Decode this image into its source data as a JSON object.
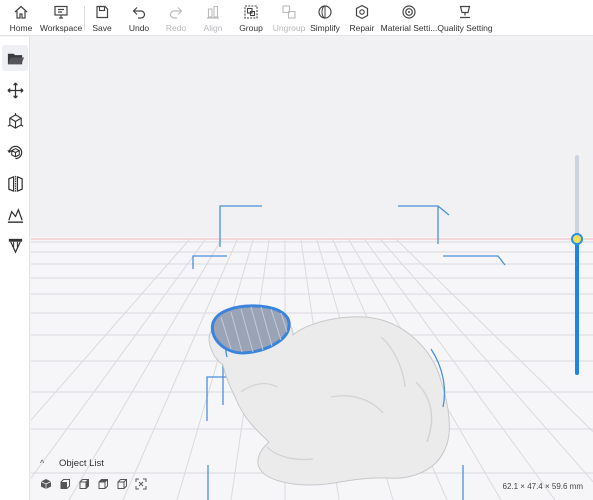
{
  "toolbar": {
    "items": [
      {
        "id": "home",
        "label": "Home",
        "icon": "home-icon",
        "enabled": true
      },
      {
        "id": "workspace",
        "label": "Workspace",
        "icon": "monitor-icon",
        "enabled": true
      },
      {
        "id": "save",
        "label": "Save",
        "icon": "save-icon",
        "enabled": true
      },
      {
        "id": "undo",
        "label": "Undo",
        "icon": "undo-icon",
        "enabled": true
      },
      {
        "id": "redo",
        "label": "Redo",
        "icon": "redo-icon",
        "enabled": false
      },
      {
        "id": "align",
        "label": "Align",
        "icon": "align-icon",
        "enabled": false
      },
      {
        "id": "group",
        "label": "Group",
        "icon": "group-icon",
        "enabled": true
      },
      {
        "id": "ungroup",
        "label": "Ungroup",
        "icon": "ungroup-icon",
        "enabled": false
      },
      {
        "id": "simplify",
        "label": "Simplify",
        "icon": "simplify-icon",
        "enabled": true
      },
      {
        "id": "repair",
        "label": "Repair",
        "icon": "repair-icon",
        "enabled": true
      },
      {
        "id": "material",
        "label": "Material Setti...",
        "icon": "material-icon",
        "enabled": true
      },
      {
        "id": "quality",
        "label": "Quality Setting",
        "icon": "quality-icon",
        "enabled": true
      }
    ]
  },
  "sidebar": {
    "tools": [
      "open-folder-icon",
      "move-icon",
      "scale-icon",
      "rotate-icon",
      "mirror-icon",
      "lay-flat-icon",
      "support-icon"
    ]
  },
  "viewport": {
    "model": "bunny",
    "layer_level": 0.62,
    "accent_color": "#1e84e6"
  },
  "object_list": {
    "title": "Object List",
    "view_icons": [
      "iso-view-icon",
      "front-view-icon",
      "left-view-icon",
      "right-view-icon",
      "top-view-icon",
      "fit-view-icon"
    ]
  },
  "status": {
    "dimensions": "62.1 × 47.4 × 59.6 mm"
  }
}
